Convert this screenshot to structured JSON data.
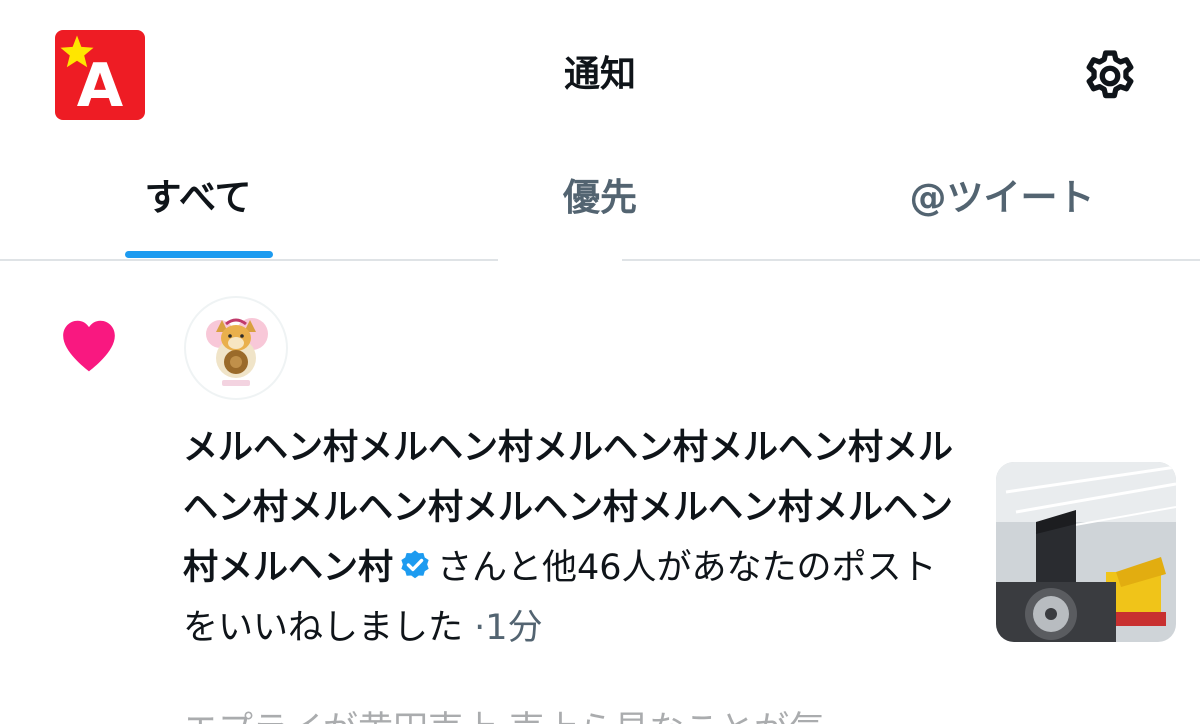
{
  "header": {
    "logo": "A",
    "title": "通知",
    "settings_icon": "gear-icon"
  },
  "tabs": [
    {
      "label": "すべて",
      "active": true
    },
    {
      "label": "優先",
      "active": false
    },
    {
      "label": "@ツイート",
      "active": false
    }
  ],
  "colors": {
    "accent": "#1d9bf0",
    "like": "#f91880",
    "logo_bg": "#ee1c24",
    "logo_star": "#ffe600",
    "verified": "#1d9bf0",
    "secondary_text": "#536471"
  },
  "notification": {
    "type_icon": "heart-icon",
    "user_name": "メルヘン村メルヘン村メルヘン村メルヘン村メルヘン村メルヘン村メルヘン村メルヘン村メルヘン村メルヘン村",
    "verified": true,
    "message": "さんと他46人があなたのポストをいいねしました",
    "separator": "·",
    "time": "1分",
    "preview_text": "エプライが黄円売上 売上ら見なことが気"
  }
}
